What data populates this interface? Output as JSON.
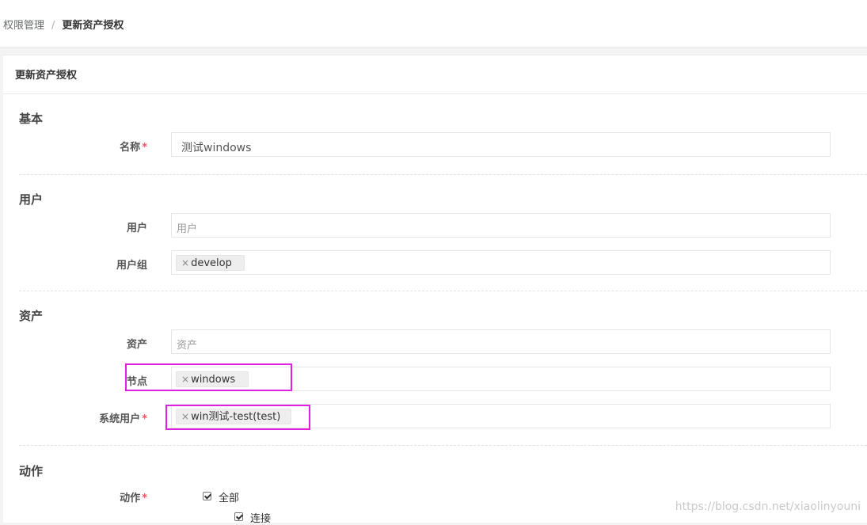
{
  "breadcrumb": {
    "parent": "权限管理",
    "separator": "/",
    "current": "更新资产授权"
  },
  "panel": {
    "title": "更新资产授权"
  },
  "sections": {
    "basic": "基本",
    "users": "用户",
    "assets": "资产",
    "actions": "动作"
  },
  "fields": {
    "name": {
      "label": "名称",
      "required": "*",
      "value": "测试windows"
    },
    "user": {
      "label": "用户",
      "placeholder": "用户"
    },
    "user_group": {
      "label": "用户组",
      "tag_remove": "×",
      "tag": "develop"
    },
    "asset": {
      "label": "资产",
      "placeholder": "资产"
    },
    "node": {
      "label": "节点",
      "tag_remove": "×",
      "tag": "windows"
    },
    "system_user": {
      "label": "系统用户",
      "required": "*",
      "tag_remove": "×",
      "tag": "win测试-test(test)"
    },
    "action": {
      "label": "动作",
      "required": "*",
      "options": [
        {
          "label": "全部",
          "checked": true
        },
        {
          "label": "连接",
          "checked": true
        }
      ]
    }
  },
  "highlight_color": "#e020e0",
  "required_color": "#ed5565",
  "watermark": "https://blog.csdn.net/xiaolinyouni"
}
